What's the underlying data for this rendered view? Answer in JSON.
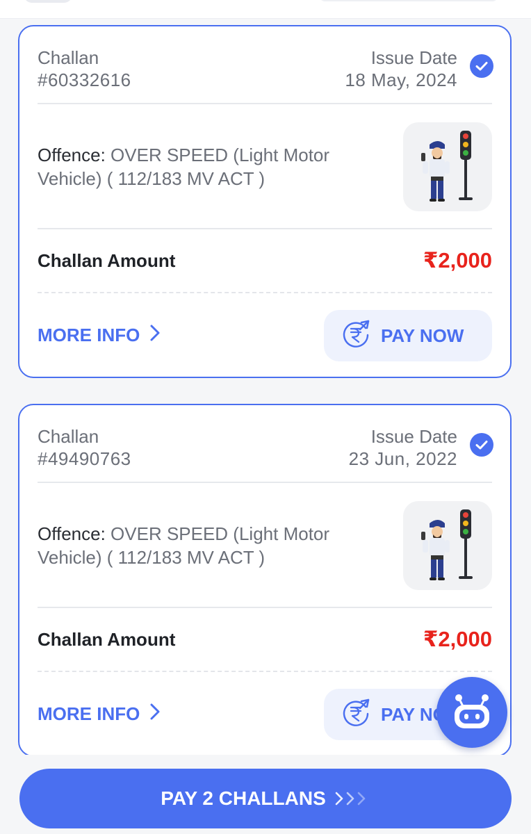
{
  "challans": [
    {
      "title": "Challan",
      "number": "#60332616",
      "issue_date_label": "Issue Date",
      "issue_date": "18 May, 2024",
      "selected": true,
      "offence_label": "Offence:",
      "offence_text": " OVER SPEED (Light Motor Vehicle) ( 112/183 MV ACT )",
      "amount_label": "Challan Amount",
      "amount": "₹2,000",
      "more_info_label": "MORE INFO",
      "pay_now_label": "PAY NOW"
    },
    {
      "title": "Challan",
      "number": "#49490763",
      "issue_date_label": "Issue Date",
      "issue_date": "23 Jun, 2022",
      "selected": true,
      "offence_label": "Offence:",
      "offence_text": " OVER SPEED (Light Motor Vehicle) ( 112/183 MV ACT )",
      "amount_label": "Challan Amount",
      "amount": "₹2,000",
      "more_info_label": "MORE INFO",
      "pay_now_label": "PAY NOW"
    }
  ],
  "footer": {
    "pay_all_label": "PAY 2 CHALLANS"
  },
  "colors": {
    "accent": "#4a6ff0",
    "amount": "#e8231c",
    "pay_now_bg": "#eef2fd",
    "page_bg": "#f5f6f8"
  },
  "icons": {
    "check": "check-circle-icon",
    "chevron": "chevron-right-icon",
    "rupee": "rupee-refresh-icon",
    "arrows": "triple-chevron-right-icon",
    "bot": "chatbot-icon",
    "illustration": "traffic-police-illustration"
  }
}
